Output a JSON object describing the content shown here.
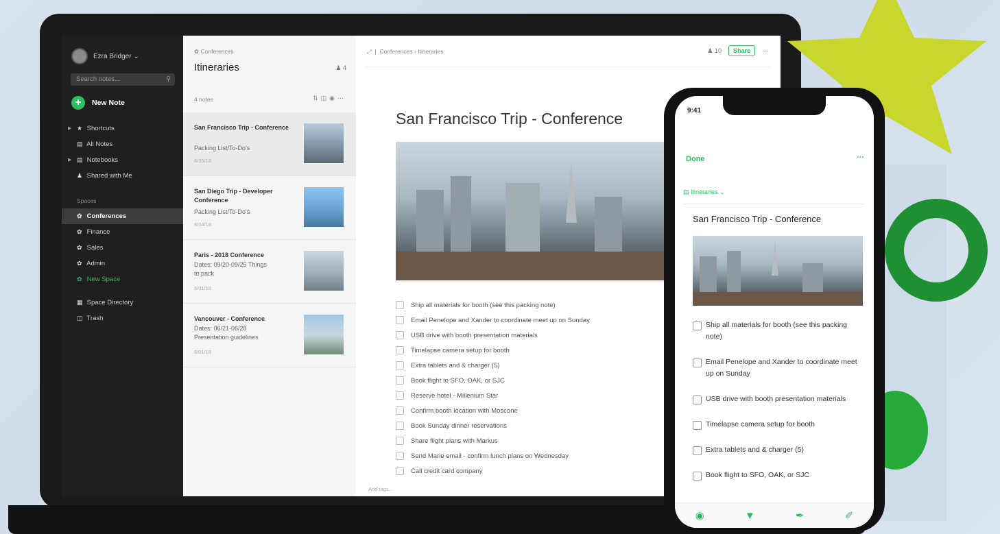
{
  "sidebar": {
    "user": "Ezra Bridger ⌄",
    "search_placeholder": "Search notes...",
    "new_note": "New Note",
    "nav": [
      {
        "label": "Shortcuts",
        "icon": "star-icon"
      },
      {
        "label": "All Notes",
        "icon": "note-icon"
      },
      {
        "label": "Notebooks",
        "icon": "notebook-icon"
      },
      {
        "label": "Shared with Me",
        "icon": "people-icon"
      }
    ],
    "spaces_label": "Spaces",
    "spaces": [
      "Conferences",
      "Finance",
      "Sales",
      "Admin",
      "New Space"
    ],
    "bottom": [
      "Space Directory",
      "Trash"
    ]
  },
  "notelist": {
    "breadcrumb": "Conferences",
    "title": "Itineraries",
    "share_count": "4",
    "count": "4 notes",
    "notes": [
      {
        "title": "San Francisco Trip - Conference",
        "snippet": "Packing List/To-Do's",
        "date": "8/05/18"
      },
      {
        "title": "San Diego Trip - Developer Conference",
        "snippet": "Packing List/To-Do's",
        "date": "8/04/18"
      },
      {
        "title": "Paris - 2018 Conference",
        "snippet": "Dates: 09/20-09/25 Things to pack",
        "date": "8/01/18"
      },
      {
        "title": "Vancouver - Conference",
        "snippet": "Dates: 06/21-06/28 Presentation guidelines",
        "date": "8/01/18"
      }
    ]
  },
  "editor": {
    "breadcrumb": "Conferences  ›  Itineraries",
    "members": "10",
    "share": "Share",
    "more": "···",
    "title": "San Francisco Trip - Conference",
    "tasks": [
      "Ship all materials for booth (see this packing note)",
      "Email Penelope and Xander to coordinate meet up on Sunday",
      "USB drive with booth presentation materials",
      "Timelapse camera setup for booth",
      "Extra tablets and & charger (5)",
      "Book flight to SFO, OAK, or SJC",
      "Reserve hotel - Millenium Star",
      "Confirm booth location with Moscone",
      "Book Sunday dinner reservations",
      "Share flight plans with Markus",
      "Send Marie email - confirm lunch plans on Wednesday",
      "Call credit card company"
    ],
    "tags_placeholder": "Add tags..."
  },
  "phone": {
    "time": "9:41",
    "done": "Done",
    "more": "···",
    "notebook": "Itineraries ⌄",
    "title": "San Francisco Trip - Conference",
    "tasks": [
      "Ship all materials for booth (see this packing note)",
      "Email Penelope and Xander to coordinate meet up on Sunday",
      "USB drive with booth presentation materials",
      "Timelapse camera setup for booth",
      "Extra tablets and & charger (5)",
      "Book flight to SFO, OAK, or SJC"
    ]
  },
  "colors": {
    "accent": "#2dbe60",
    "star": "#c8d62e",
    "ring": "#1f8f34"
  }
}
